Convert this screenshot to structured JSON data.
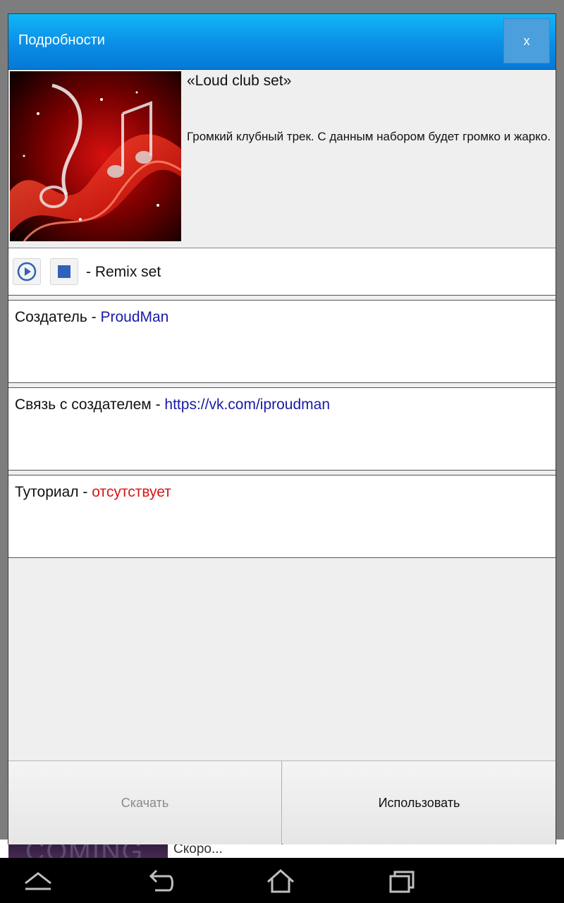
{
  "dialog": {
    "title": "Подробности",
    "close_label": "x"
  },
  "set": {
    "title": "«Loud club set»",
    "description": "Громкий клубный трек. С данным набором будет громко и жарко."
  },
  "player": {
    "label": "- Remix set",
    "play_icon": "play-circle-icon",
    "stop_icon": "stop-square-icon"
  },
  "info": {
    "creator_label": "Создатель - ",
    "creator_value": "ProudMan",
    "contact_label": "Связь с создателем - ",
    "contact_value": "https://vk.com/iproudman",
    "tutorial_label": "Туториал - ",
    "tutorial_value": "отсутствует"
  },
  "buttons": {
    "download": "Скачать",
    "use": "Использовать"
  },
  "background": {
    "thumb_text": "COMING",
    "list_text": "Скоро..."
  },
  "colors": {
    "accent": "#0a8ee6",
    "link": "#1a1aa6",
    "missing": "#d41616"
  },
  "navbar": {
    "icons": [
      "menu-up-icon",
      "back-icon",
      "home-icon",
      "recent-apps-icon"
    ]
  }
}
